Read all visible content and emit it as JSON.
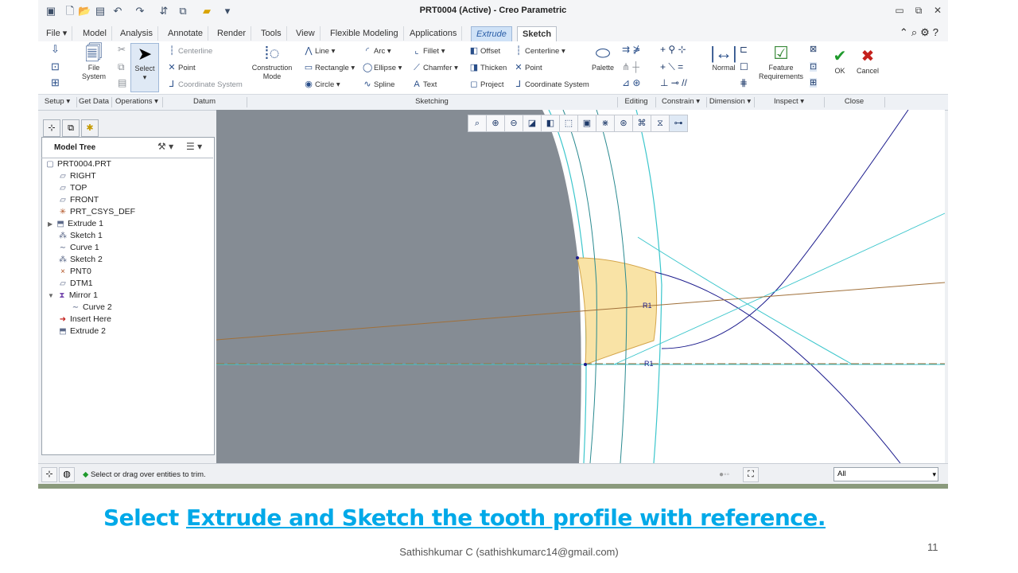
{
  "window": {
    "title": "PRT0004 (Active) - Creo Parametric",
    "controls": [
      "minimize-icon",
      "restore-icon",
      "close-icon"
    ]
  },
  "tabs": [
    {
      "label": "File",
      "dropdown": "▾"
    },
    {
      "label": "Model"
    },
    {
      "label": "Analysis"
    },
    {
      "label": "Annotate"
    },
    {
      "label": "Render"
    },
    {
      "label": "Tools"
    },
    {
      "label": "View"
    },
    {
      "label": "Flexible Modeling"
    },
    {
      "label": "Applications"
    },
    {
      "label": "Extrude"
    },
    {
      "label": "Sketch"
    }
  ],
  "ribbon": {
    "setup_file_system": "File\nSystem",
    "select": "Select",
    "datum": {
      "centerline": "Centerline",
      "point": "Point",
      "coordinate_system": "Coordinate System"
    },
    "construction_mode": "Construction\nMode",
    "sketching": {
      "line": "Line",
      "arc": "Arc",
      "fillet": "Fillet",
      "offset": "Offset",
      "centerline": "Centerline",
      "rectangle": "Rectangle",
      "ellipse": "Ellipse",
      "chamfer": "Chamfer",
      "thicken": "Thicken",
      "point": "Point",
      "circle": "Circle",
      "spline": "Spline",
      "text": "Text",
      "project": "Project",
      "coordinate_system": "Coordinate System",
      "palette": "Palette"
    },
    "dimension_normal": "Normal",
    "feature_requirements": "Feature\nRequirements",
    "ok": "OK",
    "cancel": "Cancel"
  },
  "groups": [
    {
      "label": "Setup",
      "dd": true
    },
    {
      "label": "Get Data",
      "dd": false
    },
    {
      "label": "Operations",
      "dd": true
    },
    {
      "label": "Datum",
      "dd": false
    },
    {
      "label": "Sketching",
      "dd": false
    },
    {
      "label": "Editing",
      "dd": false
    },
    {
      "label": "Constrain",
      "dd": true
    },
    {
      "label": "Dimension",
      "dd": true
    },
    {
      "label": "Inspect",
      "dd": true
    },
    {
      "label": "Close",
      "dd": false
    }
  ],
  "model_tree": {
    "header": "Model Tree",
    "items": [
      {
        "label": "PRT0004.PRT",
        "icon": "part-icon"
      },
      {
        "label": "RIGHT",
        "icon": "datum-plane-icon"
      },
      {
        "label": "TOP",
        "icon": "datum-plane-icon"
      },
      {
        "label": "FRONT",
        "icon": "datum-plane-icon"
      },
      {
        "label": "PRT_CSYS_DEF",
        "icon": "csys-icon"
      },
      {
        "label": "Extrude 1",
        "icon": "extrude-icon"
      },
      {
        "label": "Sketch 1",
        "icon": "sketch-icon"
      },
      {
        "label": "Curve 1",
        "icon": "curve-icon"
      },
      {
        "label": "Sketch 2",
        "icon": "sketch-icon"
      },
      {
        "label": "PNT0",
        "icon": "point-icon"
      },
      {
        "label": "DTM1",
        "icon": "datum-plane-icon"
      },
      {
        "label": "Mirror 1",
        "icon": "mirror-icon"
      },
      {
        "label": "Curve 2",
        "icon": "curve-icon"
      },
      {
        "label": "Insert Here",
        "icon": "insert-arrow-icon"
      },
      {
        "label": "Extrude 2",
        "icon": "extrude-icon"
      }
    ]
  },
  "graphics": {
    "dimension_labels": [
      "R1",
      "R1"
    ]
  },
  "status": {
    "message": "Select or drag over entities to trim.",
    "filter_value": "All"
  },
  "slide": {
    "caption_prefix": "Select ",
    "caption_underlined": "Extrude and Sketch the tooth profile with reference.",
    "footer": "Sathishkumar C (sathishkumarc14@gmail.com)",
    "page_number": "11"
  },
  "colors": {
    "accent": "#00a9e8",
    "solid_body": "#858c94",
    "sketch_fill": "#f9e3a6",
    "curve_blue": "#1a1a8c",
    "curve_cyan": "#3cc6cc",
    "reference_brown": "#a0703a"
  }
}
